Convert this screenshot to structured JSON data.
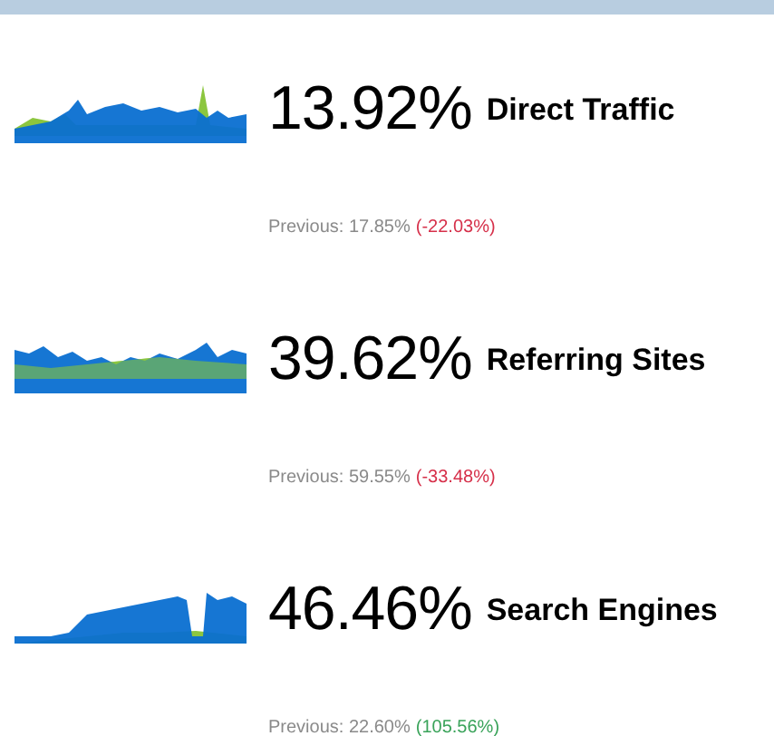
{
  "sources": [
    {
      "percent": "13.92%",
      "label": "Direct Traffic",
      "previous": "Previous: 17.85%",
      "change": "(-22.03%)",
      "color": "#d6304a"
    },
    {
      "percent": "39.62%",
      "label": "Referring Sites",
      "previous": "Previous: 59.55%",
      "change": "(-33.48%)",
      "color": "#d6304a"
    },
    {
      "percent": "46.46%",
      "label": "Search Engines",
      "previous": "Previous: 22.60%",
      "change": "(105.56%)",
      "color": "#3aa35a"
    }
  ]
}
